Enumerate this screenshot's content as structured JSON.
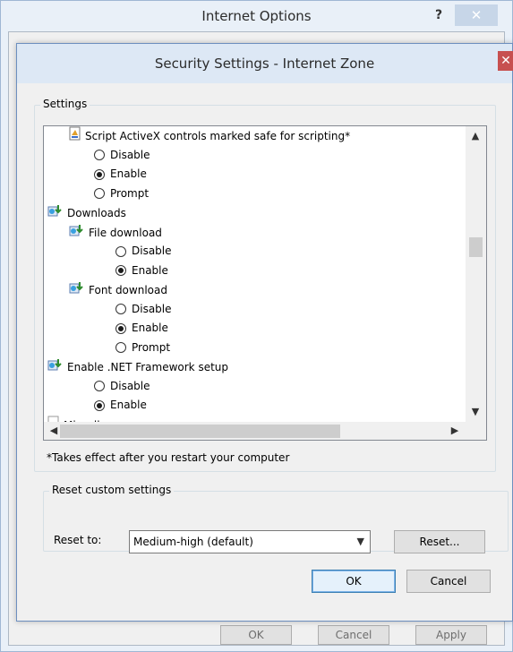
{
  "outer_window": {
    "title": "Internet Options",
    "help_glyph": "?",
    "close_glyph": "✕",
    "buttons": {
      "ok": "OK",
      "cancel": "Cancel",
      "apply": "Apply"
    }
  },
  "dialog": {
    "title": "Security Settings - Internet Zone",
    "close_glyph": "✕",
    "settings_group_label": "Settings",
    "tree": [
      {
        "kind": "item",
        "icon": "script-setting-icon",
        "label": "Script ActiveX controls marked safe for scripting*",
        "indent": 0
      },
      {
        "kind": "radio",
        "label": "Disable",
        "checked": false,
        "indent": 1
      },
      {
        "kind": "radio",
        "label": "Enable",
        "checked": true,
        "indent": 1
      },
      {
        "kind": "radio",
        "label": "Prompt",
        "checked": false,
        "indent": 1
      },
      {
        "kind": "category",
        "icon": "downloads-category-icon",
        "label": "Downloads",
        "indent": 0
      },
      {
        "kind": "item",
        "icon": "download-setting-icon",
        "label": "File download",
        "indent": 1
      },
      {
        "kind": "radio",
        "label": "Disable",
        "checked": false,
        "indent": 2
      },
      {
        "kind": "radio",
        "label": "Enable",
        "checked": true,
        "indent": 2
      },
      {
        "kind": "item",
        "icon": "download-setting-icon",
        "label": "Font download",
        "indent": 1
      },
      {
        "kind": "radio",
        "label": "Disable",
        "checked": false,
        "indent": 2
      },
      {
        "kind": "radio",
        "label": "Enable",
        "checked": true,
        "indent": 2
      },
      {
        "kind": "radio",
        "label": "Prompt",
        "checked": false,
        "indent": 2
      },
      {
        "kind": "category",
        "icon": "net-framework-icon",
        "label": "Enable .NET Framework setup",
        "indent": 0
      },
      {
        "kind": "radio",
        "label": "Disable",
        "checked": false,
        "indent": 1
      },
      {
        "kind": "radio",
        "label": "Enable",
        "checked": true,
        "indent": 1
      },
      {
        "kind": "category",
        "icon": "document-icon",
        "label": "Miscellaneous",
        "indent": 0
      }
    ],
    "scroll": {
      "vertical_position": 0.37,
      "horizontal_position": 0.0
    },
    "restart_note": "*Takes effect after you restart your computer",
    "reset_group_label": "Reset custom settings",
    "reset_to_label": "Reset to:",
    "reset_level_value": "Medium-high (default)",
    "reset_button": "Reset...",
    "ok_button": "OK",
    "cancel_button": "Cancel"
  },
  "colors": {
    "outer_titlebar": "#e9f0f8",
    "dialog_titlebar": "#dde8f5",
    "dialog_close": "#c75050",
    "default_button_border": "#3c7fb1"
  }
}
